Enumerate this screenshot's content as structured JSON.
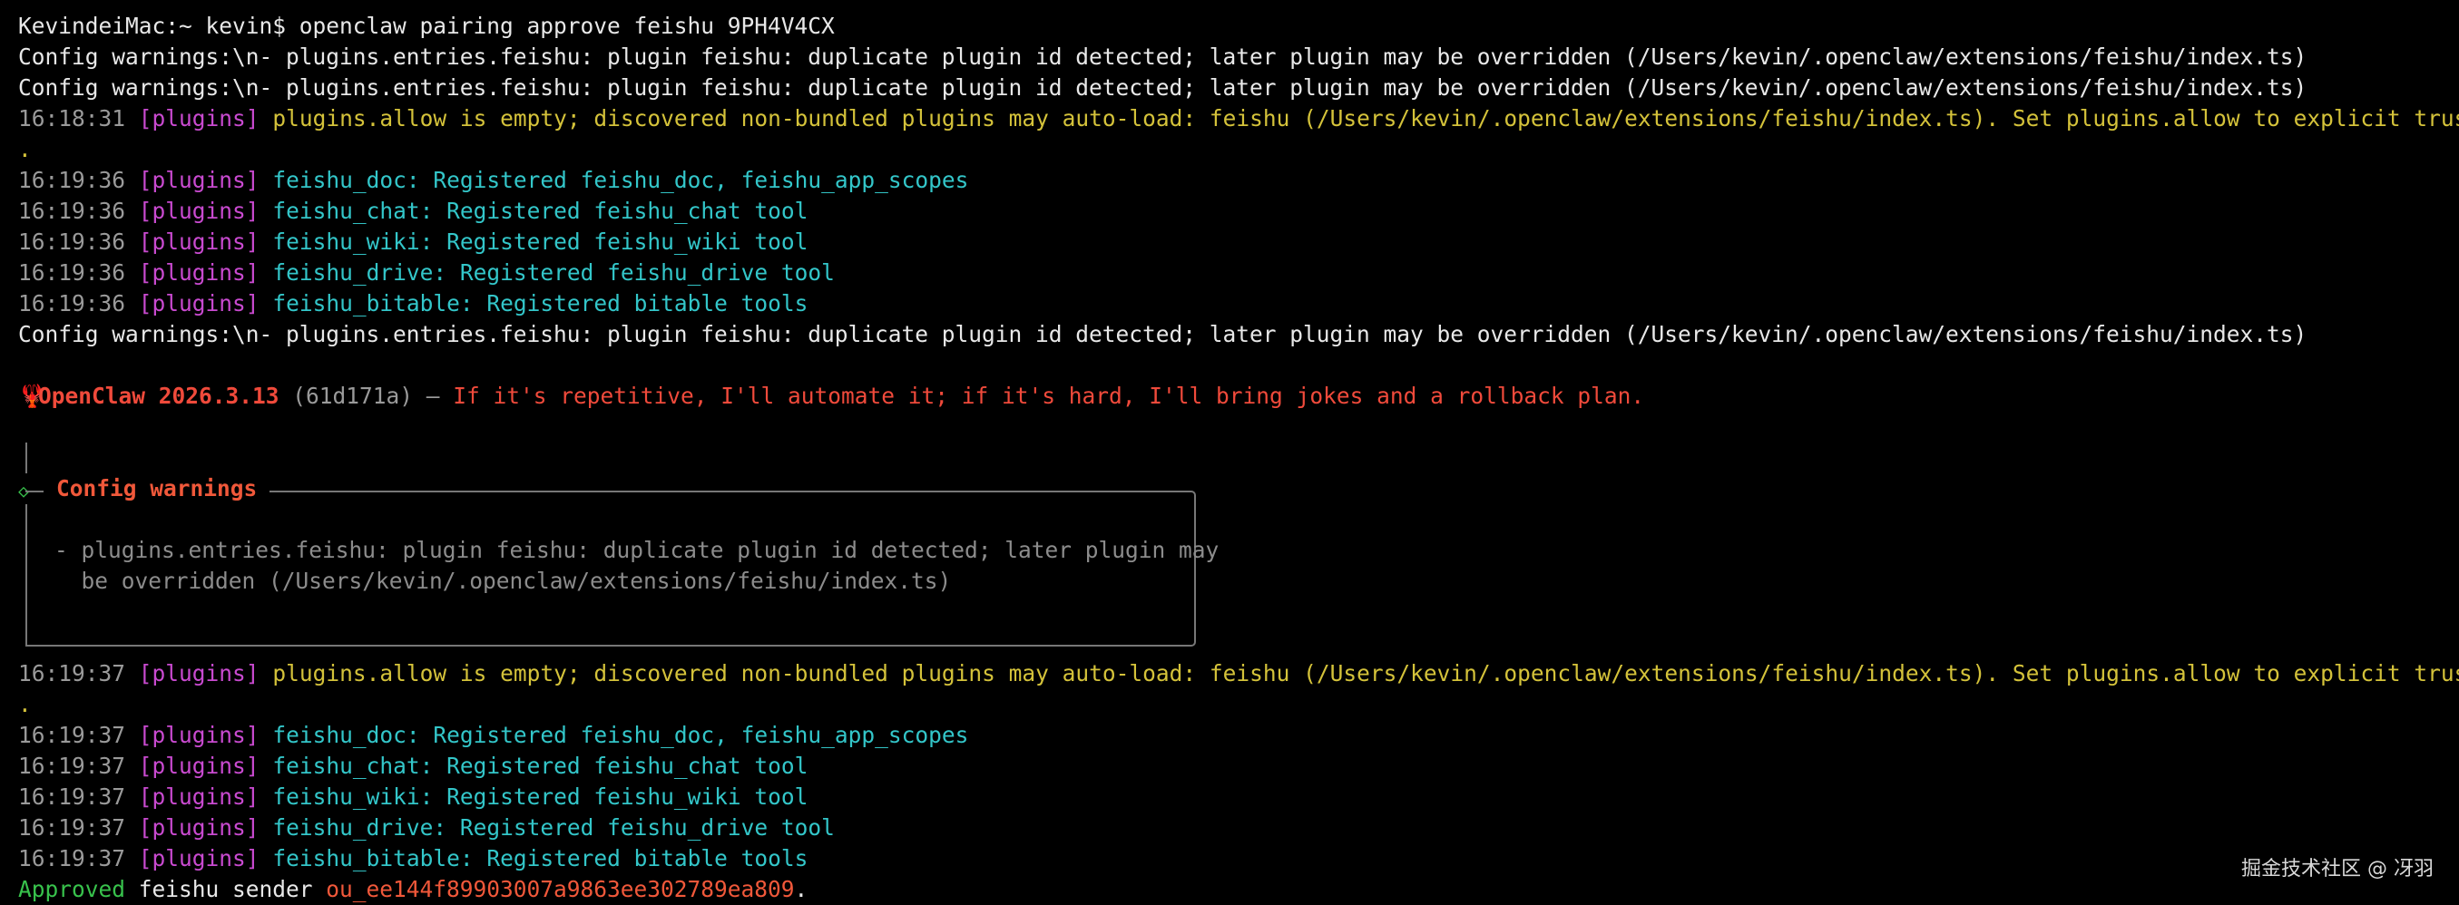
{
  "command": {
    "prompt": "KevindeiMac:~ kevin$",
    "text": " openclaw pairing approve feishu 9PH4V4CX"
  },
  "config_warning_line": "Config warnings:\\n- plugins.entries.feishu: plugin feishu: duplicate plugin id detected; later plugin may be overridden (/Users/kevin/.openclaw/extensions/feishu/index.ts)",
  "log_block_1": {
    "allow_ts": "16:18:31",
    "tag": "[plugins]",
    "allow_msg": "plugins.allow is empty; discovered non-bundled plugins may auto-load: feishu (/Users/kevin/.openclaw/extensions/feishu/index.ts). Set plugins.allow to explicit trusted ids",
    "allow_cont": ".",
    "reg_ts": "16:19:36",
    "entries": [
      {
        "tool": "feishu_doc:",
        "msg": " Registered feishu_doc, feishu_app_scopes"
      },
      {
        "tool": "feishu_chat:",
        "msg": " Registered feishu_chat tool"
      },
      {
        "tool": "feishu_wiki:",
        "msg": " Registered feishu_wiki tool"
      },
      {
        "tool": "feishu_drive:",
        "msg": " Registered feishu_drive tool"
      },
      {
        "tool": "feishu_bitable:",
        "msg": " Registered bitable tools"
      }
    ]
  },
  "banner": {
    "icon": "lobster-icon",
    "name": "OpenClaw 2026.3.13",
    "build": " (61d171a)",
    "dash": " — ",
    "tagline": "If it's repetitive, I'll automate it; if it's hard, I'll bring jokes and a rollback plan."
  },
  "config_box": {
    "title": "Config warnings",
    "line1": "- plugins.entries.feishu: plugin feishu: duplicate plugin id detected; later plugin may",
    "line2": "  be overridden (/Users/kevin/.openclaw/extensions/feishu/index.ts)"
  },
  "log_block_2": {
    "ts": "16:19:37",
    "tag": "[plugins]",
    "allow_msg": "plugins.allow is empty; discovered non-bundled plugins may auto-load: feishu (/Users/kevin/.openclaw/extensions/feishu/index.ts). Set plugins.allow to explicit trusted ids",
    "allow_cont": ".",
    "entries": [
      {
        "tool": "feishu_doc:",
        "msg": " Registered feishu_doc, feishu_app_scopes"
      },
      {
        "tool": "feishu_chat:",
        "msg": " Registered feishu_chat tool"
      },
      {
        "tool": "feishu_wiki:",
        "msg": " Registered feishu_wiki tool"
      },
      {
        "tool": "feishu_drive:",
        "msg": " Registered feishu_drive tool"
      },
      {
        "tool": "feishu_bitable:",
        "msg": " Registered bitable tools"
      }
    ]
  },
  "approved": {
    "word": "Approved",
    "mid": " feishu sender ",
    "id": "ou_ee144f89903007a9863ee302789ea809",
    "end": "."
  },
  "watermark": "掘金技术社区 @ 冴羽",
  "colors": {
    "background": "#000000",
    "timestamp": "#9a9a9a",
    "tag": "#c94ad0",
    "warning": "#d4c23a",
    "info": "#33c6c9",
    "success": "#38c24c",
    "accent": "#f0583a"
  }
}
